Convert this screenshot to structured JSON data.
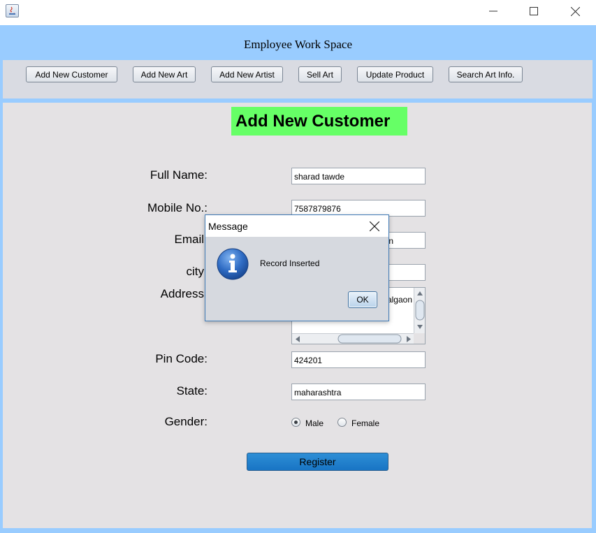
{
  "window": {
    "minimize_icon": "minimize-icon",
    "maximize_icon": "maximize-icon",
    "close_icon": "close-icon"
  },
  "header": {
    "title": "Employee Work Space"
  },
  "toolbar": {
    "buttons": [
      {
        "label": "Add New Customer"
      },
      {
        "label": "Add New Art"
      },
      {
        "label": "Add New Artist"
      },
      {
        "label": "Sell Art"
      },
      {
        "label": "Update Product"
      },
      {
        "label": "Search Art Info."
      }
    ]
  },
  "form": {
    "title": "Add New Customer",
    "title_color": "#66ff66",
    "labels": {
      "full_name": "Full Name:",
      "mobile": "Mobile No.:",
      "email": "Email",
      "city": "city",
      "address": "Address",
      "pin_code": "Pin Code:",
      "state": "State:",
      "gender": "Gender:"
    },
    "values": {
      "full_name": "sharad tawde",
      "mobile": "7587879876",
      "email": "n",
      "city": "",
      "address": "algaon",
      "pin_code": "424201",
      "state": "maharashtra"
    },
    "gender_options": [
      {
        "label": "Male",
        "selected": true
      },
      {
        "label": "Female",
        "selected": false
      }
    ],
    "register_label": "Register",
    "register_color": "#1874c4"
  },
  "dialog": {
    "title": "Message",
    "message": "Record Inserted",
    "ok_label": "OK",
    "icon": "info-icon"
  }
}
